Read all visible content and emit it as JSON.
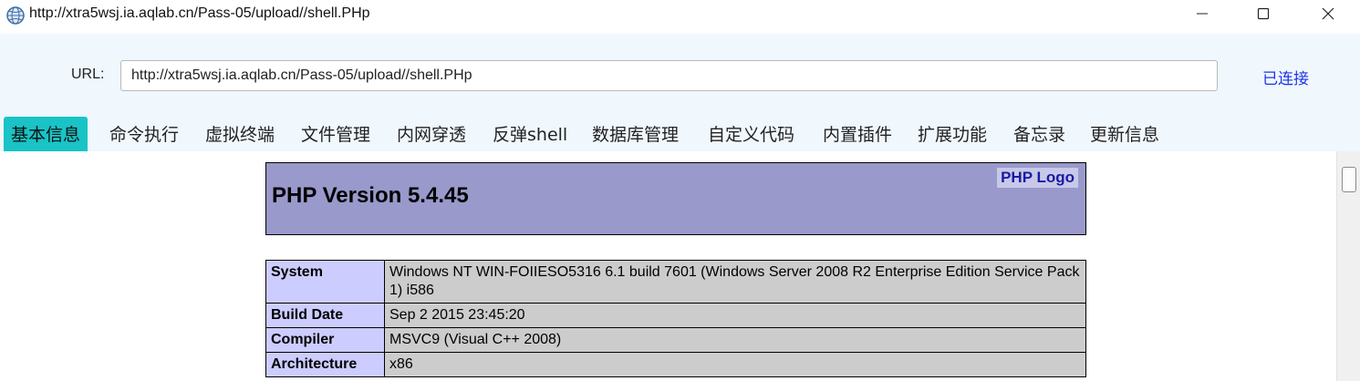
{
  "window": {
    "title": "http://xtra5wsj.ia.aqlab.cn/Pass-05/upload//shell.PHp"
  },
  "toolbar": {
    "url_label": "URL:",
    "url_value": "http://xtra5wsj.ia.aqlab.cn/Pass-05/upload//shell.PHp",
    "status": "已连接"
  },
  "tabs": [
    {
      "label": "基本信息",
      "active": true
    },
    {
      "label": "命令执行"
    },
    {
      "label": "虚拟终端"
    },
    {
      "label": "文件管理"
    },
    {
      "label": "内网穿透"
    },
    {
      "label": "反弹shell"
    },
    {
      "label": "数据库管理"
    },
    {
      "label": "自定义代码"
    },
    {
      "label": "内置插件"
    },
    {
      "label": "扩展功能"
    },
    {
      "label": "备忘录"
    },
    {
      "label": "更新信息"
    }
  ],
  "phpinfo": {
    "version_title": "PHP Version 5.4.45",
    "logo_text": "PHP Logo",
    "rows": [
      {
        "key": "System",
        "value": "Windows NT WIN-FOIIESO5316 6.1 build 7601 (Windows Server 2008 R2 Enterprise Edition Service Pack 1) i586"
      },
      {
        "key": "Build Date",
        "value": "Sep 2 2015 23:45:20"
      },
      {
        "key": "Compiler",
        "value": "MSVC9 (Visual C++ 2008)"
      },
      {
        "key": "Architecture",
        "value": "x86"
      }
    ]
  },
  "colors": {
    "active_tab": "#19c3c6",
    "status_link": "#1b35e8",
    "php_header": "#9999cc",
    "php_key_cell": "#ccccff",
    "php_value_cell": "#cccccc"
  },
  "icons": {
    "app": "globe-app-icon",
    "minimize": "minimize-icon",
    "maximize": "maximize-icon",
    "close": "close-icon"
  }
}
